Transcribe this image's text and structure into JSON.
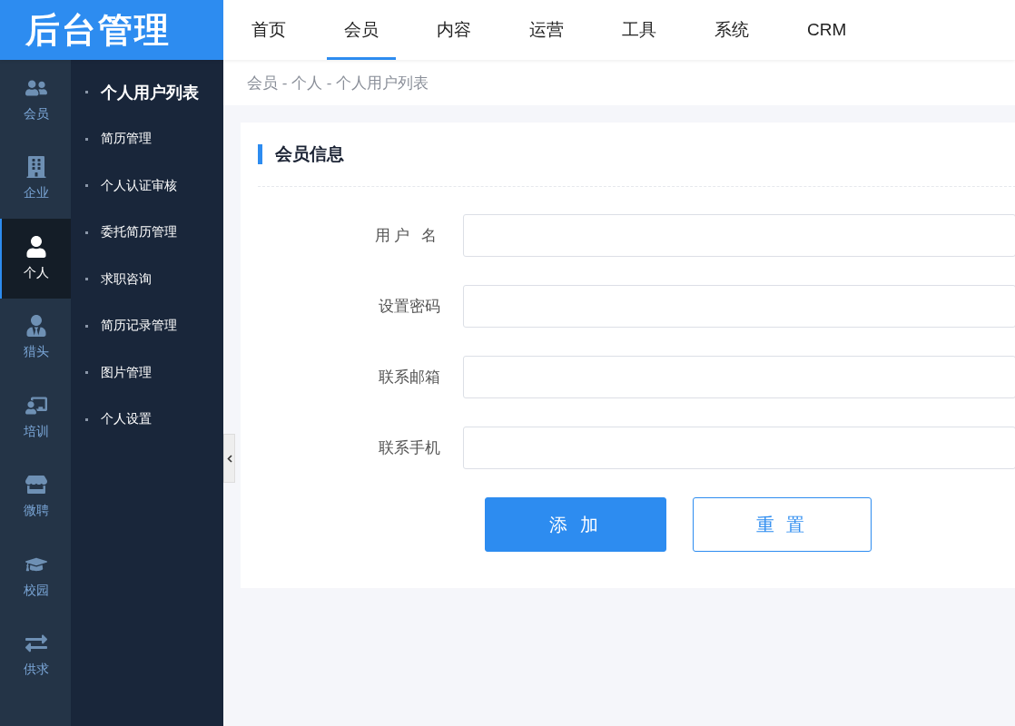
{
  "logo": "后台管理",
  "top_nav": [
    {
      "label": "首页",
      "selected": false
    },
    {
      "label": "会员",
      "selected": true
    },
    {
      "label": "内容",
      "selected": false
    },
    {
      "label": "运营",
      "selected": false
    },
    {
      "label": "工具",
      "selected": false
    },
    {
      "label": "系统",
      "selected": false
    },
    {
      "label": "CRM",
      "selected": false
    }
  ],
  "rail": [
    {
      "label": "会员",
      "kind": "members",
      "selected": false
    },
    {
      "label": "企业",
      "kind": "company",
      "selected": false
    },
    {
      "label": "个人",
      "kind": "person",
      "selected": true
    },
    {
      "label": "猎头",
      "kind": "headhunter",
      "selected": false
    },
    {
      "label": "培训",
      "kind": "training",
      "selected": false
    },
    {
      "label": "微聘",
      "kind": "store",
      "selected": false
    },
    {
      "label": "校园",
      "kind": "campus",
      "selected": false
    },
    {
      "label": "供求",
      "kind": "exchange",
      "selected": false
    }
  ],
  "submenu": [
    {
      "label": "个人用户列表",
      "selected": true
    },
    {
      "label": "简历管理",
      "selected": false
    },
    {
      "label": "个人认证审核",
      "selected": false
    },
    {
      "label": "委托简历管理",
      "selected": false
    },
    {
      "label": "求职咨询",
      "selected": false
    },
    {
      "label": "简历记录管理",
      "selected": false
    },
    {
      "label": "图片管理",
      "selected": false
    },
    {
      "label": "个人设置",
      "selected": false
    }
  ],
  "breadcrumb": "会员 - 个人 - 个人用户列表",
  "section_title": "会员信息",
  "fields": [
    {
      "label": "用户 名"
    },
    {
      "label": "设置密码"
    },
    {
      "label": "联系邮箱"
    },
    {
      "label": "联系手机"
    }
  ],
  "buttons": [
    {
      "label": "添 加",
      "kind": "primary"
    },
    {
      "label": "重 置",
      "kind": "outline"
    }
  ]
}
